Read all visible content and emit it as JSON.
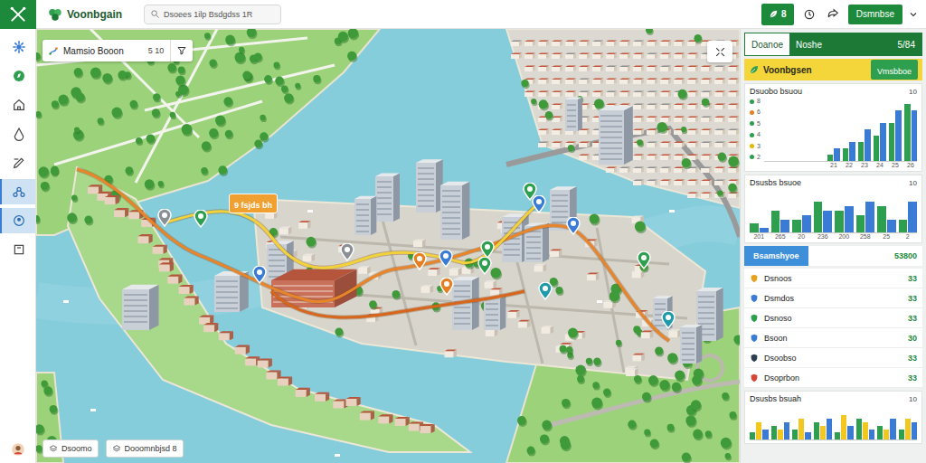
{
  "app": {
    "logo": "Voonbgain"
  },
  "search": {
    "value": "Dsoees 1ilp Bsdgdss 1R"
  },
  "toolbar": {
    "badge": "8",
    "action": "Dsmnbse"
  },
  "sidebar": {
    "items": [
      {
        "selected": false
      },
      {
        "selected": false
      },
      {
        "selected": false
      },
      {
        "selected": false
      },
      {
        "selected": false
      },
      {
        "selected": true
      },
      {
        "selected": true
      },
      {
        "selected": false
      }
    ]
  },
  "map": {
    "search_card": {
      "title": "Mamsio Booon",
      "count": "5 10"
    },
    "route_label": "9 fsjds bh",
    "chips": [
      "Dsoomo",
      "Dooomnbjsd 8"
    ],
    "pins": [
      {
        "color": "#8a9096"
      },
      {
        "color": "#2e9e4f"
      },
      {
        "color": "#3a7bd5"
      },
      {
        "color": "#8a9096"
      },
      {
        "color": "#e67e22"
      },
      {
        "color": "#3a7bd5"
      },
      {
        "color": "#e67e22"
      },
      {
        "color": "#2e9e4f"
      },
      {
        "color": "#2e9e4f"
      },
      {
        "color": "#2e9e4f"
      },
      {
        "color": "#3a7bd5"
      },
      {
        "color": "#3a7bd5"
      },
      {
        "color": "#1f9aa8"
      },
      {
        "color": "#2e9e4f"
      },
      {
        "color": "#1f9aa8"
      }
    ]
  },
  "panel": {
    "tabs": [
      {
        "label": "Doanoe",
        "selected": true
      },
      {
        "label": "Noshe",
        "selected": false
      },
      {
        "label": "5/84",
        "selected": false
      }
    ],
    "summary": {
      "title": "Voonbgsen",
      "action": "Vmsbboe"
    },
    "charts": [
      {
        "title": "Dsuobo bsuou",
        "max_label": "10",
        "axis_max": 10,
        "legend": [
          {
            "label": "8",
            "color": "#2e9e4f"
          },
          {
            "label": "6",
            "color": "#e67e22"
          },
          {
            "label": "5",
            "color": "#2e9e4f"
          },
          {
            "label": "4",
            "color": "#2e9e4f"
          },
          {
            "label": "3",
            "color": "#e6b800"
          },
          {
            "label": "2",
            "color": "#2e9e4f"
          }
        ],
        "x_ticks": [
          "21",
          "22",
          "23",
          "24",
          "25",
          "26"
        ],
        "series": [
          {
            "color": "#2e9e4f",
            "values": [
              1,
              2,
              3,
              4,
              6,
              9
            ]
          },
          {
            "color": "#3a7bd5",
            "values": [
              2,
              3,
              5,
              6,
              8,
              8
            ]
          }
        ]
      },
      {
        "title": "Dsusbs bsuoe",
        "max_label": "10",
        "axis_max": 10,
        "legend": [],
        "x_ticks": [
          "201",
          "265",
          "20",
          "236",
          "200",
          "258",
          "25",
          "2"
        ],
        "series": [
          {
            "color": "#2e9e4f",
            "values": [
              2,
              5,
              3,
              7,
              5,
              4,
              6,
              3
            ]
          },
          {
            "color": "#3a7bd5",
            "values": [
              1,
              3,
              4,
              5,
              6,
              7,
              3,
              7
            ]
          }
        ]
      },
      {
        "title": "Dsusbs bsuah",
        "max_label": "10",
        "axis_max": 10,
        "legend": [],
        "x_ticks": [],
        "series": [
          {
            "color": "#2e9e4f",
            "values": [
              2,
              4,
              3,
              5,
              2,
              6,
              4,
              3
            ]
          },
          {
            "color": "#f2c81e",
            "values": [
              5,
              3,
              6,
              4,
              7,
              5,
              3,
              6
            ]
          },
          {
            "color": "#3a7bd5",
            "values": [
              3,
              5,
              2,
              6,
              4,
              3,
              6,
              5
            ]
          }
        ]
      }
    ],
    "list": {
      "title": "Bsamshyoe",
      "total": "53800",
      "rows": [
        {
          "label": "Dsnoos",
          "value": "33",
          "color": "#e6a21e"
        },
        {
          "label": "Dsmdos",
          "value": "33",
          "color": "#3a7bd5"
        },
        {
          "label": "Dsnoso",
          "value": "33",
          "color": "#2e9e4f"
        },
        {
          "label": "Bsoon",
          "value": "30",
          "color": "#3a7bd5"
        },
        {
          "label": "Dsoobso",
          "value": "33",
          "color": "#2d3e50"
        },
        {
          "label": "Dsoprbon",
          "value": "33",
          "color": "#d64535"
        }
      ]
    }
  }
}
